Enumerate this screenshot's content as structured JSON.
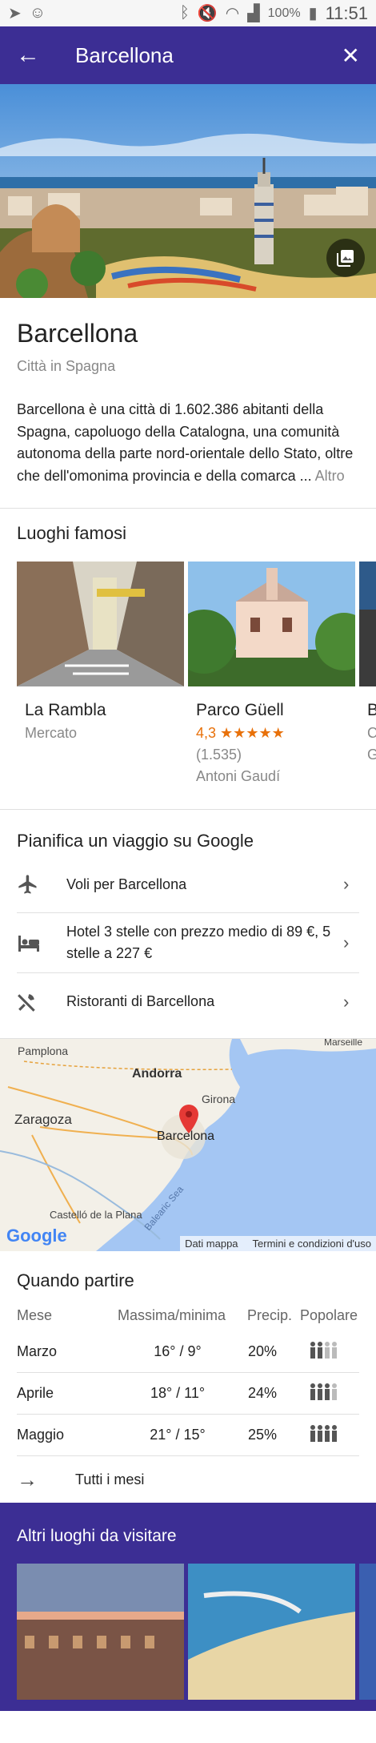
{
  "status_bar": {
    "battery": "100%",
    "time": "11:51"
  },
  "app_bar": {
    "title": "Barcellona"
  },
  "place": {
    "name": "Barcellona",
    "subtitle": "Città in Spagna",
    "description": "Barcellona è una città di 1.602.386 abitanti della Spagna, capoluogo della Catalogna, una comunità autonoma della parte nord-orientale dello Stato, oltre che dell'omonima provincia e della comarca ...",
    "more_label": "Altro"
  },
  "famous": {
    "title": "Luoghi famosi",
    "items": [
      {
        "name": "La Rambla",
        "line1": "Mercato"
      },
      {
        "name": "Parco Güell",
        "rating": "4,3",
        "stars": "★★★★★",
        "reviews": "(1.535)",
        "line2": "Antoni Gaudí"
      },
      {
        "name": "B",
        "line1": "C",
        "line2": "G"
      }
    ]
  },
  "plan": {
    "title": "Pianifica un viaggio su Google",
    "rows": [
      {
        "label": "Voli per Barcellona",
        "icon": "airplane-icon"
      },
      {
        "label": "Hotel 3 stelle con prezzo medio di 89 €, 5 stelle a 227 €",
        "icon": "bed-icon"
      },
      {
        "label": "Ristoranti di Barcellona",
        "icon": "restaurant-icon"
      }
    ]
  },
  "map": {
    "labels": {
      "pamplona": "Pamplona",
      "andorra": "Andorra",
      "zaragoza": "Zaragoza",
      "girona": "Girona",
      "barcelona": "Barcelona",
      "castello": "Castelló de la Plana",
      "sea": "Balearic Sea",
      "marseille": "Marseille"
    },
    "logo": "Google",
    "credits_data": "Dati mappa",
    "credits_terms": "Termini e condizioni d'uso"
  },
  "when": {
    "title": "Quando partire",
    "headers": {
      "month": "Mese",
      "temp": "Massima/minima",
      "precip": "Precip.",
      "popular": "Popolare"
    },
    "rows": [
      {
        "month": "Marzo",
        "temp": "16° / 9°",
        "precip": "20%",
        "popularity": 0.5
      },
      {
        "month": "Aprile",
        "temp": "18° / 11°",
        "precip": "24%",
        "popularity": 0.75
      },
      {
        "month": "Maggio",
        "temp": "21° / 15°",
        "precip": "25%",
        "popularity": 1
      }
    ],
    "all_months": "Tutti i mesi"
  },
  "others": {
    "title": "Altri luoghi da visitare"
  },
  "colors": {
    "primary": "#3c2e94",
    "rating": "#e8710a",
    "map_pin": "#e53935"
  }
}
